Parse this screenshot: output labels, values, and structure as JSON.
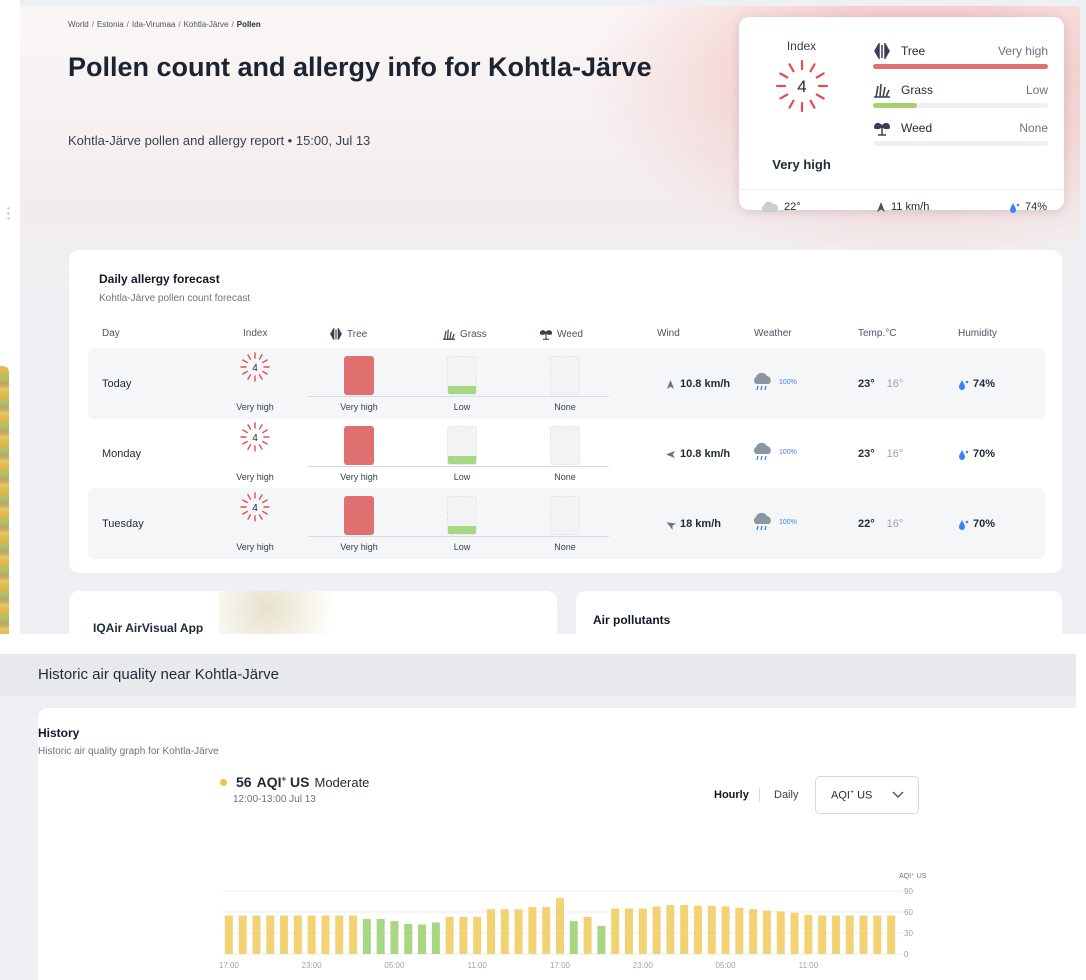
{
  "breadcrumb": {
    "items": [
      "World",
      "Estonia",
      "Ida-Virumaa",
      "Kohtla-Järve"
    ],
    "current": "Pollen",
    "separator": "/"
  },
  "header": {
    "title": "Pollen count and allergy info for Kohtla-Järve",
    "subtitle": "Kohtla-Järve pollen and allergy report • 15:00, Jul 13"
  },
  "index_card": {
    "label": "Index",
    "value": "4",
    "level": "Very high",
    "pollens": [
      {
        "name": "Tree",
        "value": "Very high",
        "icon": "tree-icon",
        "fill": 1.0,
        "color": "#e07070"
      },
      {
        "name": "Grass",
        "value": "Low",
        "icon": "grass-icon",
        "fill": 0.25,
        "color": "#a6d06b"
      },
      {
        "name": "Weed",
        "value": "None",
        "icon": "weed-icon",
        "fill": 0,
        "color": "#a6d06b"
      }
    ],
    "weather": {
      "temp": "22°",
      "wind": "11 km/h",
      "humidity": "74%"
    }
  },
  "forecast": {
    "title": "Daily allergy forecast",
    "subtitle": "Kohtla-Järve pollen count forecast",
    "headers": {
      "day": "Day",
      "index": "Index",
      "tree": "Tree",
      "grass": "Grass",
      "weed": "Weed",
      "wind": "Wind",
      "weather": "Weather",
      "temp": "Temp.°C",
      "humidity": "Humidity"
    },
    "rows": [
      {
        "day": "Today",
        "index": "4",
        "index_level": "Very high",
        "tree": "Very high",
        "grass": "Low",
        "weed": "None",
        "tree_fill": 1.0,
        "grass_fill": 0.25,
        "weed_fill": 0,
        "wind": "10.8 km/h",
        "weather": "100%",
        "temp_high": "23°",
        "temp_low": "16°",
        "humidity": "74%"
      },
      {
        "day": "Monday",
        "index": "4",
        "index_level": "Very high",
        "tree": "Very high",
        "grass": "Low",
        "weed": "None",
        "tree_fill": 1.0,
        "grass_fill": 0.25,
        "weed_fill": 0,
        "wind": "10.8 km/h",
        "weather": "100%",
        "temp_high": "23°",
        "temp_low": "16°",
        "humidity": "70%"
      },
      {
        "day": "Tuesday",
        "index": "4",
        "index_level": "Very high",
        "tree": "Very high",
        "grass": "Low",
        "weed": "None",
        "tree_fill": 1.0,
        "grass_fill": 0.25,
        "weed_fill": 0,
        "wind": "18 km/h",
        "weather": "100%",
        "temp_high": "22°",
        "temp_low": "16°",
        "humidity": "70%"
      }
    ]
  },
  "app_card": {
    "title": "IQAir AirVisual App"
  },
  "pollutants_card": {
    "title": "Air pollutants"
  },
  "history": {
    "section_title": "Historic air quality near Kohtla-Järve",
    "title": "History",
    "subtitle": "Historic air quality graph for Kohtla-Järve",
    "current": {
      "value": "56",
      "unit_main": "AQI",
      "unit_sup": "+",
      "unit_suffix": "US",
      "status": "Moderate",
      "time": "12:00-13:00 Jul 13"
    },
    "toggle": {
      "hourly": "Hourly",
      "daily": "Daily"
    },
    "select": {
      "label": "AQI",
      "sup": "+",
      "suffix": "US"
    }
  },
  "colors": {
    "moderate": "#f2d374",
    "good": "#a7d783",
    "tree_bar": "#e07070",
    "accent": "#3b82f6"
  },
  "chart_data": {
    "type": "bar",
    "y_axis_title": "AQI⁺ US",
    "ylim": [
      0,
      90
    ],
    "y_ticks": [
      0,
      30,
      60,
      90
    ],
    "x_tick_labels": [
      "17:00",
      "23:00",
      "05:00",
      "11:00",
      "17:00",
      "23:00",
      "05:00",
      "11:00"
    ],
    "values": [
      55,
      55,
      55,
      55,
      55,
      55,
      55,
      55,
      55,
      55,
      50,
      50,
      47,
      43,
      42,
      45,
      53,
      53,
      53,
      64,
      64,
      64,
      67,
      67,
      80,
      47,
      53,
      40,
      65,
      65,
      65,
      68,
      70,
      70,
      69,
      69,
      68,
      66,
      64,
      62,
      61,
      59,
      56,
      55,
      55,
      55,
      55,
      55,
      55
    ],
    "categories_per_bar": "hourly",
    "moderate_threshold": 51,
    "grid": true
  }
}
